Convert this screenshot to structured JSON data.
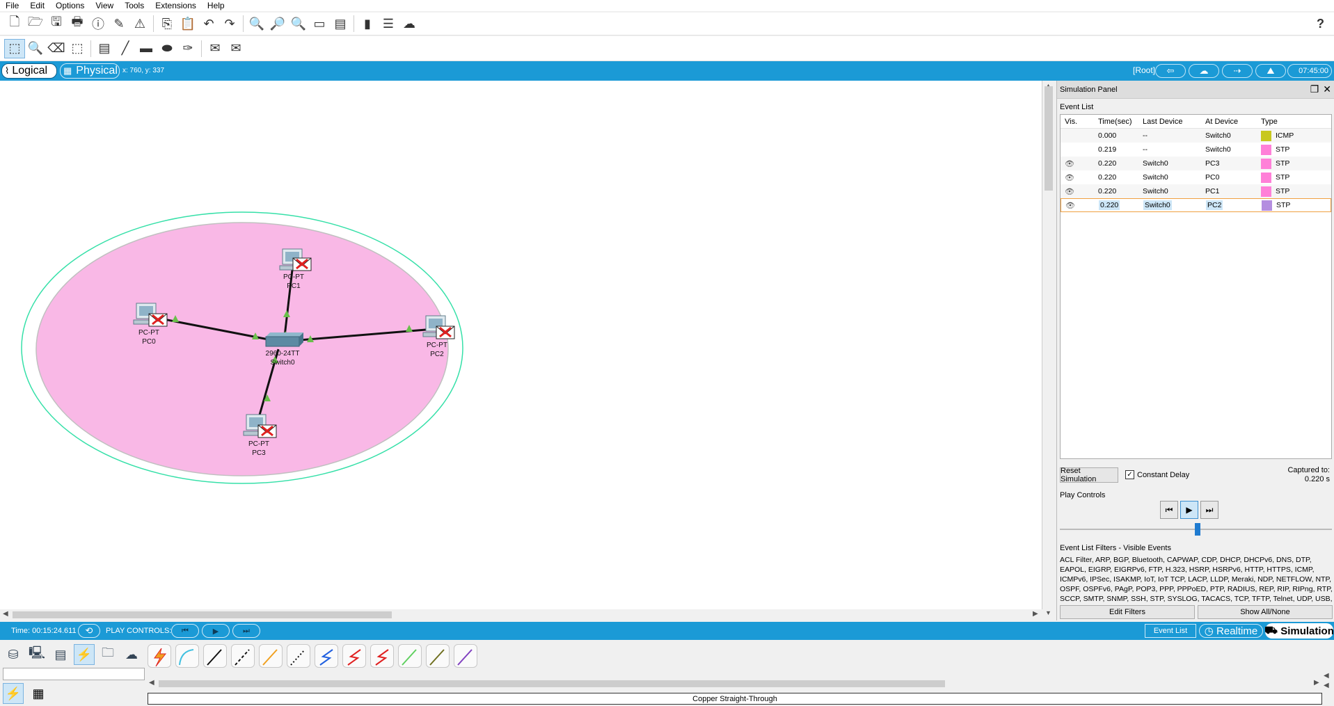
{
  "menu": [
    "File",
    "Edit",
    "Options",
    "View",
    "Tools",
    "Extensions",
    "Help"
  ],
  "toolbar_main_icons": [
    "new-file-icon",
    "open-folder-icon",
    "save-icon",
    "print-icon",
    "info-icon",
    "activity-wizard-icon",
    "network-info-icon",
    "copy-icon",
    "paste-icon",
    "undo-icon",
    "redo-icon",
    "zoom-in-icon",
    "zoom-reset-icon",
    "zoom-out-icon",
    "drawing-palette-icon",
    "custom-device-dialog-icon",
    "pdu-icon",
    "cluster-icon",
    "cloud-icon"
  ],
  "toolbar_tools_icons": [
    "select-icon",
    "inspect-icon",
    "delete-icon",
    "resize-icon",
    "note-icon",
    "line-icon",
    "rectangle-icon",
    "ellipse-icon",
    "freeform-icon",
    "simple-pdu-icon",
    "complex-pdu-icon"
  ],
  "help_glyph": "?",
  "modebar": {
    "logical_label": "Logical",
    "physical_label": "Physical",
    "coords": "x: 760, y: 337",
    "root_label": "[Root]",
    "clock": "07:45:00"
  },
  "topology": {
    "devices": [
      {
        "model": "PC-PT",
        "name": "PC1"
      },
      {
        "model": "PC-PT",
        "name": "PC0"
      },
      {
        "model": "PC-PT",
        "name": "PC2"
      },
      {
        "model": "PC-PT",
        "name": "PC3"
      },
      {
        "model": "2960-24TT",
        "name": "Switch0"
      }
    ],
    "colors": {
      "fill": "#f9b8e6",
      "outline": "#35e0a8",
      "link": "#111111",
      "port_up": "#6abf4b",
      "pdu_red": "#e02020"
    }
  },
  "simpanel": {
    "title": "Simulation Panel",
    "event_list_label": "Event List",
    "columns": [
      "Vis.",
      "Time(sec)",
      "Last Device",
      "At Device",
      "Type"
    ],
    "events": [
      {
        "time": "0.000",
        "last": "--",
        "at": "Switch0",
        "type": "ICMP",
        "color": "#c8c820"
      },
      {
        "time": "0.219",
        "last": "--",
        "at": "Switch0",
        "type": "STP",
        "color": "#ff80d8"
      },
      {
        "time": "0.220",
        "last": "Switch0",
        "at": "PC3",
        "type": "STP",
        "color": "#ff80d8"
      },
      {
        "time": "0.220",
        "last": "Switch0",
        "at": "PC0",
        "type": "STP",
        "color": "#ff80d8"
      },
      {
        "time": "0.220",
        "last": "Switch0",
        "at": "PC1",
        "type": "STP",
        "color": "#ff80d8"
      },
      {
        "time": "0.220",
        "last": "Switch0",
        "at": "PC2",
        "type": "STP",
        "color": "#b48ee0"
      }
    ],
    "reset_label": "Reset Simulation",
    "constant_delay_label": "Constant Delay",
    "captured_label": "Captured to:",
    "captured_value": "0.220 s",
    "play_controls_label": "Play Controls",
    "filters_label": "Event List Filters - Visible Events",
    "filters_text": "ACL Filter, ARP, BGP, Bluetooth, CAPWAP, CDP, DHCP, DHCPv6, DNS, DTP, EAPOL, EIGRP, EIGRPv6, FTP, H.323, HSRP, HSRPv6, HTTP, HTTPS, ICMP, ICMPv6, IPSec, ISAKMP, IoT, IoT TCP, LACP, LLDP, Meraki, NDP, NETFLOW, NTP, OSPF, OSPFv6, PAgP, POP3, PPP, PPPoED, PTP, RADIUS, REP, RIP, RIPng, RTP, SCCP, SMTP, SNMP, SSH, STP, SYSLOG, TACACS, TCP, TFTP, Telnet, UDP, USB, VTP",
    "edit_filters_label": "Edit Filters",
    "show_all_label": "Show All/None"
  },
  "statusbar": {
    "time": "Time: 00:15:24.611",
    "play_label": "PLAY CONTROLS:",
    "event_list_btn": "Event List",
    "realtime_btn": "Realtime",
    "simulation_btn": "Simulation"
  },
  "palette": {
    "cable_caption": "Copper Straight-Through",
    "cable_colors": [
      "#f0a020",
      "#40c0e0",
      "#111111",
      "#111111",
      "#f0a020",
      "#111111",
      "#2060e0",
      "#e02020",
      "#e02020",
      "#60d060",
      "#707020",
      "#8040c0"
    ]
  }
}
